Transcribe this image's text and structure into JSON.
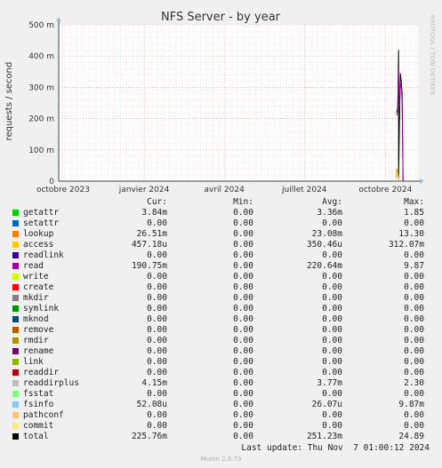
{
  "chart_data": {
    "type": "line",
    "title": "NFS Server - by year",
    "ylabel": "requests / second",
    "side_text": "RRDTOOL / TOBI OETIKER",
    "ylim": [
      0,
      500
    ],
    "yticks": [
      {
        "v": 0,
        "label": "0"
      },
      {
        "v": 100,
        "label": "100 m"
      },
      {
        "v": 200,
        "label": "200 m"
      },
      {
        "v": 300,
        "label": "300 m"
      },
      {
        "v": 400,
        "label": "400 m"
      },
      {
        "v": 500,
        "label": "500 m"
      }
    ],
    "xlim": [
      "2023-09-26",
      "2024-11-07"
    ],
    "xticks": [
      {
        "date": "2023-10-01",
        "label": "octobre 2023"
      },
      {
        "date": "2024-01-01",
        "label": "janvier 2024"
      },
      {
        "date": "2024-04-01",
        "label": "avril 2024"
      },
      {
        "date": "2024-07-01",
        "label": "juillet 2024"
      },
      {
        "date": "2024-10-01",
        "label": "octobre 2024"
      }
    ],
    "series": [
      {
        "name": "total",
        "color": "#000000",
        "points": [
          [
            "2024-10-14",
            220
          ],
          [
            "2024-10-15",
            235
          ],
          [
            "2024-10-16",
            420
          ],
          [
            "2024-10-16",
            10
          ],
          [
            "2024-10-17",
            200
          ],
          [
            "2024-10-18",
            345
          ],
          [
            "2024-10-19",
            320
          ],
          [
            "2024-10-20",
            280
          ],
          [
            "2024-10-21",
            0
          ]
        ]
      },
      {
        "name": "read",
        "color": "#990099",
        "points": [
          [
            "2024-10-14",
            210
          ],
          [
            "2024-10-15",
            225
          ],
          [
            "2024-10-16",
            355
          ],
          [
            "2024-10-17",
            240
          ],
          [
            "2024-10-18",
            300
          ],
          [
            "2024-10-19",
            310
          ],
          [
            "2024-10-20",
            250
          ],
          [
            "2024-10-21",
            0
          ]
        ]
      },
      {
        "name": "lookup",
        "color": "#ff8800",
        "points": [
          [
            "2024-10-13",
            10
          ],
          [
            "2024-10-14",
            40
          ],
          [
            "2024-10-15",
            30
          ],
          [
            "2024-10-16",
            12
          ],
          [
            "2024-10-17",
            5
          ]
        ]
      },
      {
        "name": "access",
        "color": "#ffcc00",
        "points": [
          [
            "2024-10-13",
            5
          ],
          [
            "2024-10-14",
            25
          ],
          [
            "2024-10-15",
            15
          ],
          [
            "2024-10-16",
            8
          ]
        ]
      }
    ]
  },
  "legend": {
    "headers": {
      "cur": "Cur:",
      "min": "Min:",
      "avg": "Avg:",
      "max": "Max:"
    },
    "rows": [
      {
        "name": "getattr",
        "color": "#00cc00",
        "cur": "3.84m",
        "min": "0.00",
        "avg": "3.36m",
        "max": "1.85"
      },
      {
        "name": "setattr",
        "color": "#0066b3",
        "cur": "0.00",
        "min": "0.00",
        "avg": "0.00",
        "max": "0.00"
      },
      {
        "name": "lookup",
        "color": "#ff8000",
        "cur": "26.51m",
        "min": "0.00",
        "avg": "23.08m",
        "max": "13.30"
      },
      {
        "name": "access",
        "color": "#ffcc00",
        "cur": "457.18u",
        "min": "0.00",
        "avg": "350.46u",
        "max": "312.07m"
      },
      {
        "name": "readlink",
        "color": "#330099",
        "cur": "0.00",
        "min": "0.00",
        "avg": "0.00",
        "max": "0.00"
      },
      {
        "name": "read",
        "color": "#990099",
        "cur": "190.75m",
        "min": "0.00",
        "avg": "220.64m",
        "max": "9.87"
      },
      {
        "name": "write",
        "color": "#ccff00",
        "cur": "0.00",
        "min": "0.00",
        "avg": "0.00",
        "max": "0.00"
      },
      {
        "name": "create",
        "color": "#ff0000",
        "cur": "0.00",
        "min": "0.00",
        "avg": "0.00",
        "max": "0.00"
      },
      {
        "name": "mkdir",
        "color": "#808080",
        "cur": "0.00",
        "min": "0.00",
        "avg": "0.00",
        "max": "0.00"
      },
      {
        "name": "symlink",
        "color": "#008f00",
        "cur": "0.00",
        "min": "0.00",
        "avg": "0.00",
        "max": "0.00"
      },
      {
        "name": "mknod",
        "color": "#00487d",
        "cur": "0.00",
        "min": "0.00",
        "avg": "0.00",
        "max": "0.00"
      },
      {
        "name": "remove",
        "color": "#b35a00",
        "cur": "0.00",
        "min": "0.00",
        "avg": "0.00",
        "max": "0.00"
      },
      {
        "name": "rmdir",
        "color": "#b38f00",
        "cur": "0.00",
        "min": "0.00",
        "avg": "0.00",
        "max": "0.00"
      },
      {
        "name": "rename",
        "color": "#6b006b",
        "cur": "0.00",
        "min": "0.00",
        "avg": "0.00",
        "max": "0.00"
      },
      {
        "name": "link",
        "color": "#8fb300",
        "cur": "0.00",
        "min": "0.00",
        "avg": "0.00",
        "max": "0.00"
      },
      {
        "name": "readdir",
        "color": "#b30000",
        "cur": "0.00",
        "min": "0.00",
        "avg": "0.00",
        "max": "0.00"
      },
      {
        "name": "readdirplus",
        "color": "#bebebe",
        "cur": "4.15m",
        "min": "0.00",
        "avg": "3.77m",
        "max": "2.30"
      },
      {
        "name": "fsstat",
        "color": "#80ff80",
        "cur": "0.00",
        "min": "0.00",
        "avg": "0.00",
        "max": "0.00"
      },
      {
        "name": "fsinfo",
        "color": "#80c9ff",
        "cur": "52.08u",
        "min": "0.00",
        "avg": "26.07u",
        "max": "9.87m"
      },
      {
        "name": "pathconf",
        "color": "#ffc080",
        "cur": "0.00",
        "min": "0.00",
        "avg": "0.00",
        "max": "0.00"
      },
      {
        "name": "commit",
        "color": "#ffe680",
        "cur": "0.00",
        "min": "0.00",
        "avg": "0.00",
        "max": "0.00"
      },
      {
        "name": "total",
        "color": "#000000",
        "cur": "225.76m",
        "min": "0.00",
        "avg": "251.23m",
        "max": "24.89"
      }
    ]
  },
  "last_update": "Last update: Thu Nov  7 01:00:12 2024",
  "footer": "Munin 2.0.73"
}
